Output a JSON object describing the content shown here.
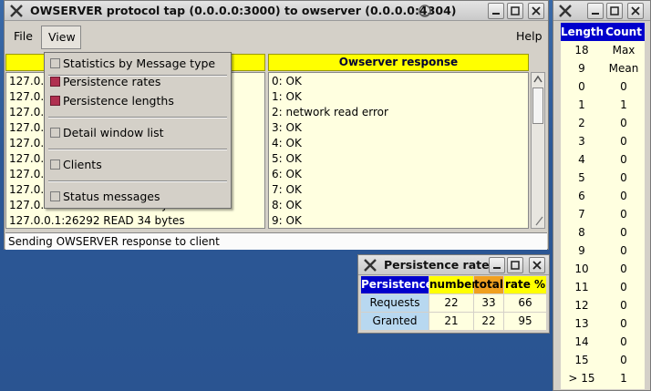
{
  "colors": {
    "header_yellow": "#ffff00",
    "pane_bg": "#ffffe0",
    "blue_header": "#0000cc",
    "total_orange": "#f0a020",
    "persistence_light": "#b8d8f0",
    "checked": "#b03050"
  },
  "main_window": {
    "title": "OWSERVER protocol tap (0.0.0.0:3000) to owserver (0.0.0.0:4304)",
    "menu": {
      "file": "File",
      "view": "View",
      "help": "Help"
    },
    "right_header": "Owserver response",
    "left_rows": [
      "127.0.",
      "127.0.",
      "127.0.",
      "127.0.",
      "127.0.",
      "127.0.",
      "127.0.",
      "127.0.",
      "127.0.0.1:26292 READ 34 bytes",
      "127.0.0.1:26292 READ 34 bytes"
    ],
    "right_rows": [
      "0: OK",
      "1: OK",
      "2: network read error",
      "3: OK",
      "4: OK",
      "5: OK",
      "6: OK",
      "7: OK",
      "8: OK",
      "9: OK"
    ],
    "status": "Sending OWSERVER response to client"
  },
  "view_menu": {
    "items": [
      {
        "label": "Statistics by Message type",
        "checked": false
      },
      {
        "label": "Persistence rates",
        "checked": true
      },
      {
        "label": "Persistence lengths",
        "checked": true
      },
      {
        "label": "Detail window list",
        "checked": false
      },
      {
        "label": "Clients",
        "checked": false
      },
      {
        "label": "Status messages",
        "checked": false
      }
    ]
  },
  "persistence_window": {
    "title": "Persistence rates",
    "headers": [
      "Persistence",
      "number",
      "total",
      "rate %"
    ],
    "rows": [
      {
        "label": "Requests",
        "number": "22",
        "total": "33",
        "rate": "66"
      },
      {
        "label": "Granted",
        "number": "21",
        "total": "22",
        "rate": "95"
      }
    ]
  },
  "lengths_window": {
    "headers": [
      "Length",
      "Count"
    ],
    "summary": [
      {
        "a": "18",
        "b": "Max"
      },
      {
        "a": "9",
        "b": "Mean"
      }
    ],
    "rows": [
      {
        "length": "0",
        "count": "0"
      },
      {
        "length": "1",
        "count": "1"
      },
      {
        "length": "2",
        "count": "0"
      },
      {
        "length": "3",
        "count": "0"
      },
      {
        "length": "4",
        "count": "0"
      },
      {
        "length": "5",
        "count": "0"
      },
      {
        "length": "6",
        "count": "0"
      },
      {
        "length": "7",
        "count": "0"
      },
      {
        "length": "8",
        "count": "0"
      },
      {
        "length": "9",
        "count": "0"
      },
      {
        "length": "10",
        "count": "0"
      },
      {
        "length": "11",
        "count": "0"
      },
      {
        "length": "12",
        "count": "0"
      },
      {
        "length": "13",
        "count": "0"
      },
      {
        "length": "14",
        "count": "0"
      },
      {
        "length": "15",
        "count": "0"
      },
      {
        "length": "> 15",
        "count": "1"
      }
    ]
  }
}
